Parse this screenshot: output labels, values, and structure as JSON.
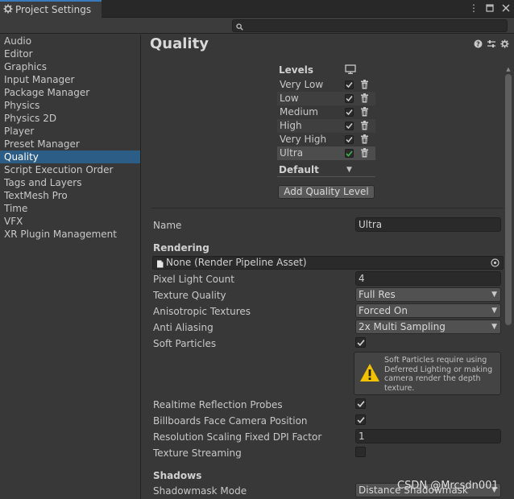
{
  "window": {
    "tab_title": "Project Settings",
    "search_placeholder": ""
  },
  "sidebar": {
    "items": [
      {
        "label": "Audio"
      },
      {
        "label": "Editor"
      },
      {
        "label": "Graphics"
      },
      {
        "label": "Input Manager"
      },
      {
        "label": "Package Manager"
      },
      {
        "label": "Physics"
      },
      {
        "label": "Physics 2D"
      },
      {
        "label": "Player"
      },
      {
        "label": "Preset Manager"
      },
      {
        "label": "Quality",
        "selected": true
      },
      {
        "label": "Script Execution Order"
      },
      {
        "label": "Tags and Layers"
      },
      {
        "label": "TextMesh Pro"
      },
      {
        "label": "Time"
      },
      {
        "label": "VFX"
      },
      {
        "label": "XR Plugin Management"
      }
    ]
  },
  "main": {
    "title": "Quality",
    "levels_label": "Levels",
    "levels": [
      {
        "name": "Very Low",
        "enabled": true
      },
      {
        "name": "Low",
        "enabled": true
      },
      {
        "name": "Medium",
        "enabled": true
      },
      {
        "name": "High",
        "enabled": true
      },
      {
        "name": "Very High",
        "enabled": true
      },
      {
        "name": "Ultra",
        "enabled": true,
        "selected": true
      }
    ],
    "default_label": "Default",
    "add_level_label": "Add Quality Level",
    "name_label": "Name",
    "name_value": "Ultra",
    "rendering_label": "Rendering",
    "render_pipeline_asset": "None (Render Pipeline Asset)",
    "pixel_light_count_label": "Pixel Light Count",
    "pixel_light_count_value": "4",
    "texture_quality_label": "Texture Quality",
    "texture_quality_value": "Full Res",
    "anisotropic_label": "Anisotropic Textures",
    "anisotropic_value": "Forced On",
    "anti_aliasing_label": "Anti Aliasing",
    "anti_aliasing_value": "2x Multi Sampling",
    "soft_particles_label": "Soft Particles",
    "soft_particles_checked": true,
    "soft_particles_help": "Soft Particles require using Deferred Lighting or making camera render the depth texture.",
    "realtime_reflection_label": "Realtime Reflection Probes",
    "realtime_reflection_checked": true,
    "billboards_label": "Billboards Face Camera Position",
    "billboards_checked": true,
    "res_scaling_label": "Resolution Scaling Fixed DPI Factor",
    "res_scaling_value": "1",
    "texture_streaming_label": "Texture Streaming",
    "texture_streaming_checked": false,
    "shadows_label": "Shadows",
    "shadowmask_label": "Shadowmask Mode",
    "shadowmask_value": "Distance Shadowmask"
  },
  "watermark": "CSDN @Mrcsdn001",
  "colors": {
    "selection": "#2c5d87",
    "check_default": "#d0d0d0",
    "check_selected": "#3bb34a",
    "warning": "#f2c200"
  }
}
